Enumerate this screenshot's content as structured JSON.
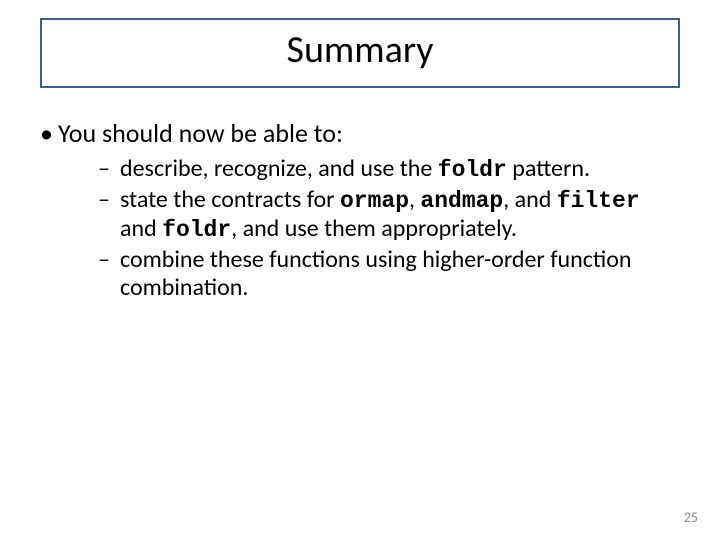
{
  "title": "Summary",
  "lead": "You should now be able to:",
  "items": {
    "i0a": "describe, recognize, and use the ",
    "i0code": "foldr",
    "i0b": " pattern.",
    "i1a": "state the contracts for ",
    "i1c1": "ormap",
    "i1b": ", ",
    "i1c2": "andmap",
    "i1c": ", and ",
    "i1c3": "filter",
    "i1d": " and ",
    "i1c4": "foldr",
    "i1e": ", and use them appropriately.",
    "i2": "combine these functions using higher-order function combination."
  },
  "pagenum": "25"
}
